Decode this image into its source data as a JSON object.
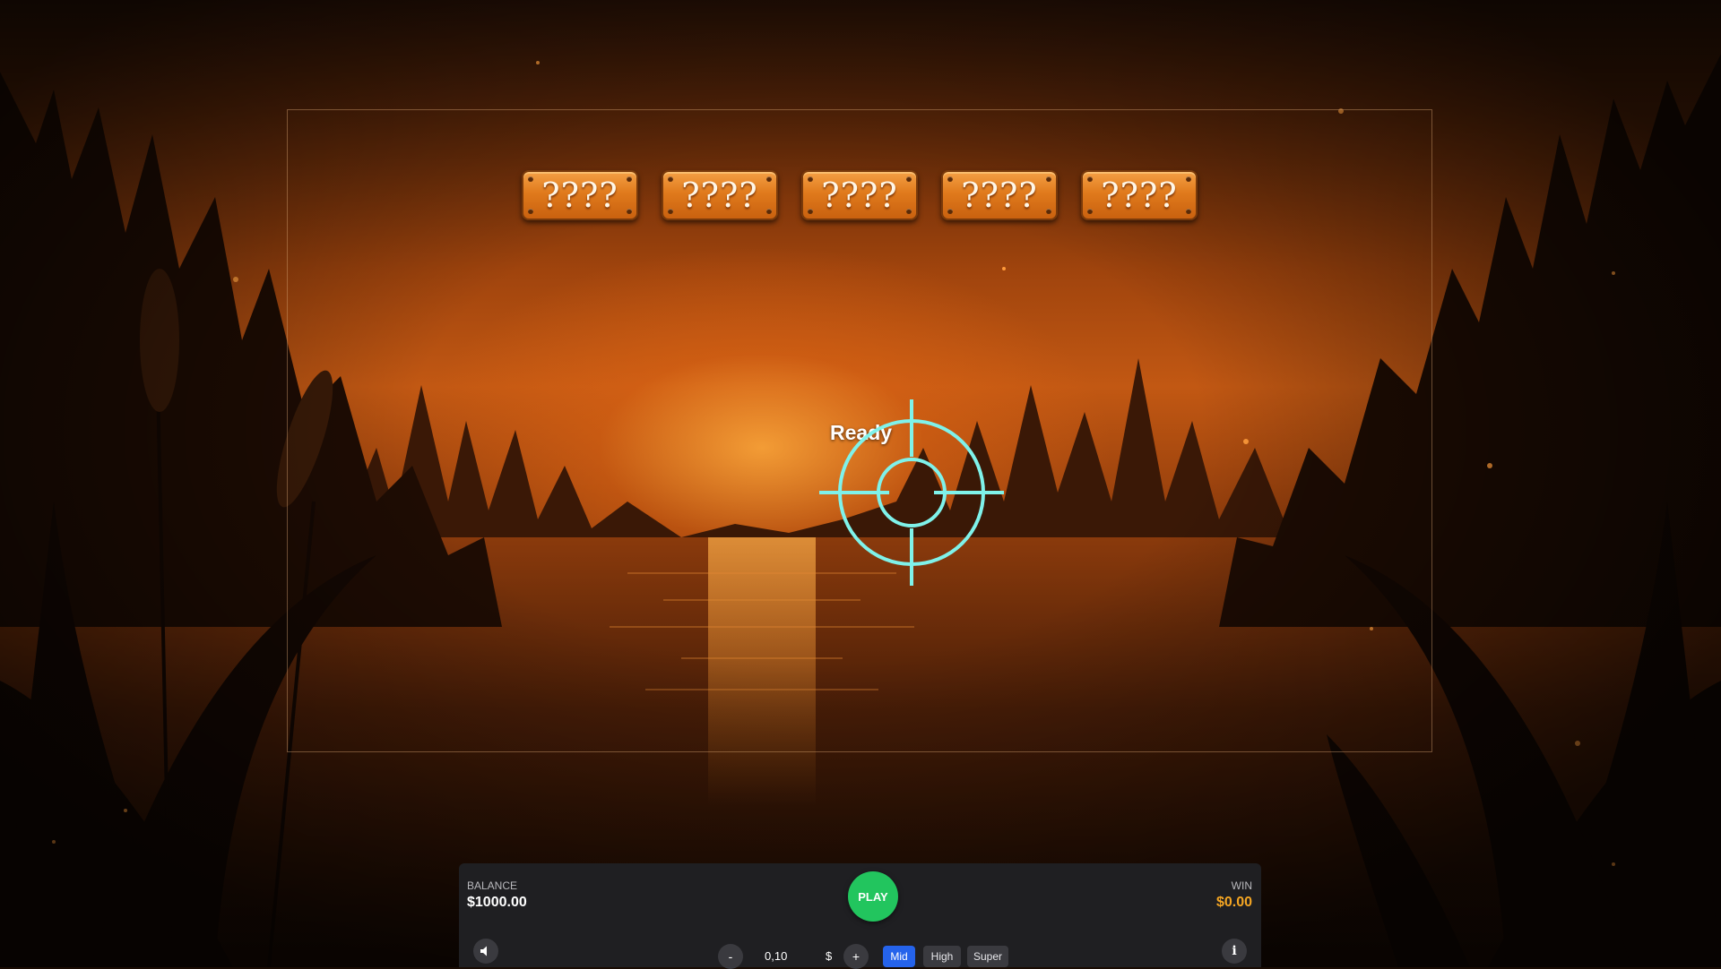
{
  "game": {
    "plaques": [
      "????",
      "????",
      "????",
      "????",
      "????"
    ],
    "status_text": "Ready"
  },
  "panel": {
    "balance_label": "BALANCE",
    "balance_value": "$1000.00",
    "win_label": "WIN",
    "win_value": "$0.00",
    "play_label": "PLAY",
    "bet_value": "0,10",
    "currency": "$",
    "minus_label": "-",
    "plus_label": "+",
    "info_label": "i",
    "modes": [
      "Mid",
      "High",
      "Super"
    ],
    "active_mode": "Mid"
  },
  "icons": {
    "sound": "speaker-icon",
    "crosshair": "crosshair-icon"
  },
  "colors": {
    "play": "#22c55e",
    "active_mode": "#2563eb",
    "win_value": "#f5a623",
    "crosshair": "#7ff2ea",
    "panel": "#1f1f22"
  }
}
